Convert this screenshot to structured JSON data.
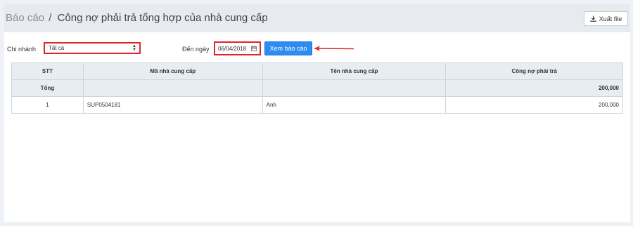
{
  "header": {
    "breadcrumb": "Báo cáo",
    "separator": "/",
    "title": "Công nợ phải trả tổng hợp của nhà cung cấp",
    "export_label": "Xuất file"
  },
  "filters": {
    "branch_label": "Chi nhánh",
    "branch_value": "Tất cả",
    "date_label": "Đến ngày",
    "date_value": "06/04/2018",
    "view_button": "Xem báo cáo"
  },
  "table": {
    "columns": [
      "STT",
      "Mã nhà cung cấp",
      "Tên nhà cung cấp",
      "Công nợ phải trả"
    ],
    "total": {
      "label": "Tổng",
      "code": "",
      "name": "",
      "debt": "200,000"
    },
    "rows": [
      {
        "stt": "1",
        "code": "SUP0504181",
        "name": "Anh",
        "debt": "200,000"
      }
    ]
  },
  "colors": {
    "accent": "#2d8cf0",
    "highlight": "#e0242f",
    "header_bg": "#e7eaef"
  },
  "icons": {
    "export": "download-icon",
    "date": "calendar-icon",
    "select": "sort-caret-icon",
    "annotation": "arrow-left-icon"
  }
}
